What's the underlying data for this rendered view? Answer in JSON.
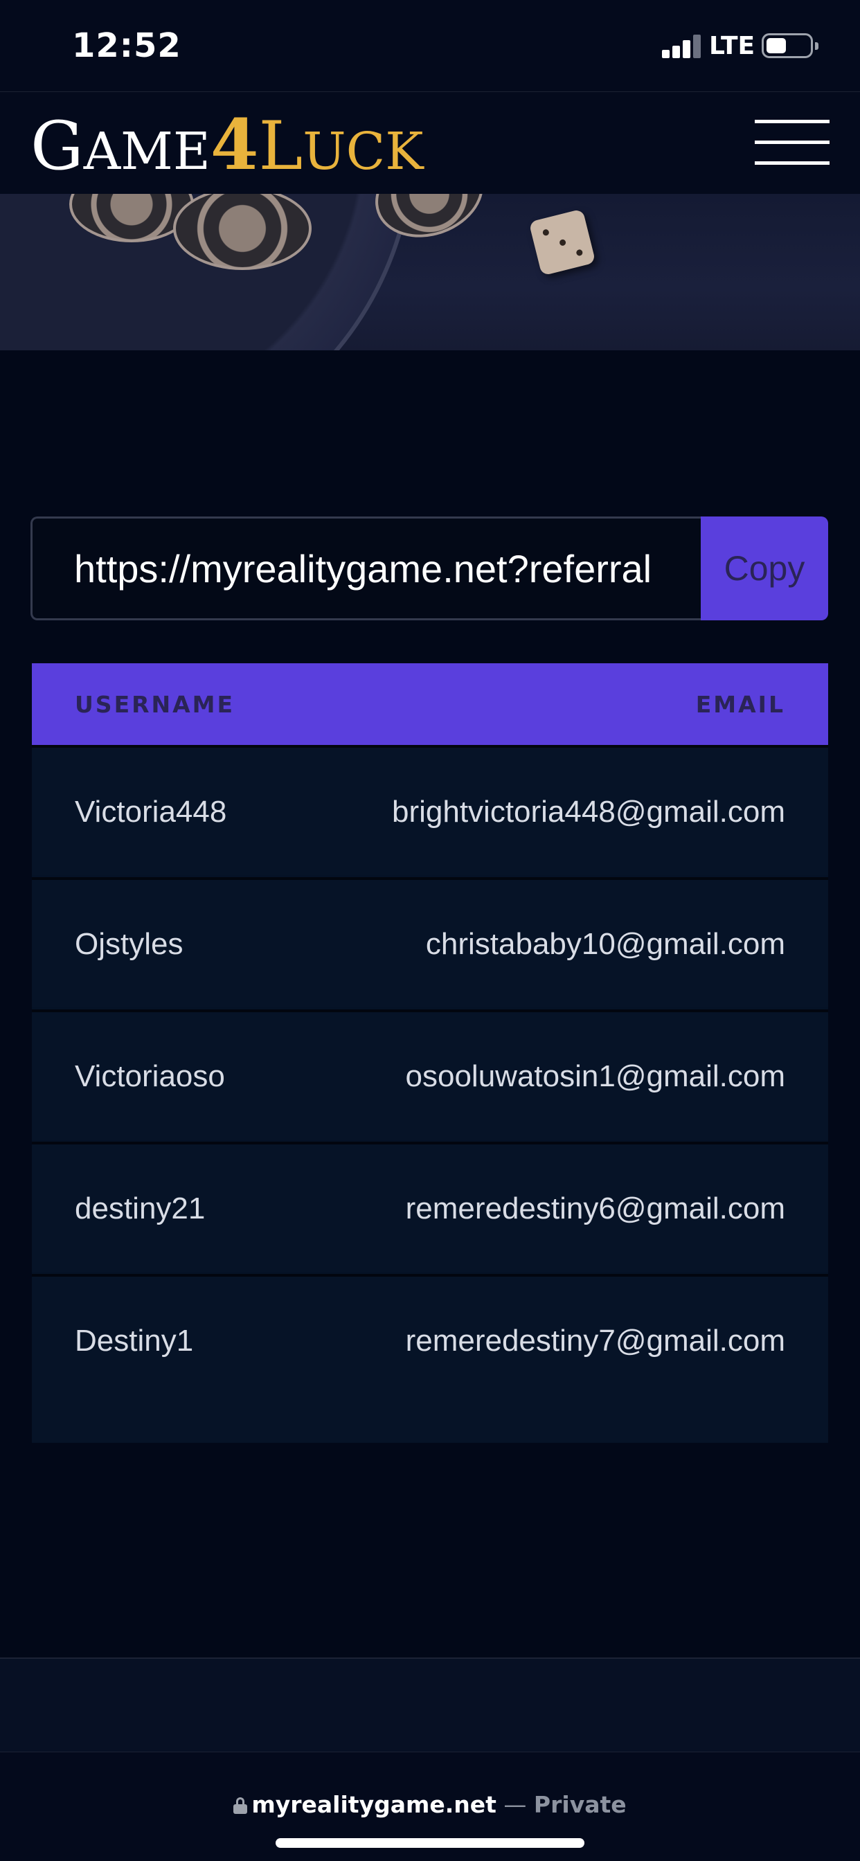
{
  "status_bar": {
    "time": "12:52",
    "network": "LTE",
    "icons": [
      "signal-icon",
      "battery-icon"
    ]
  },
  "header": {
    "logo": {
      "part1_initial": "G",
      "part1_rest": "AME",
      "part2_number": "4",
      "part2_initial": "L",
      "part2_rest": "UCK"
    },
    "menu_icon": "hamburger-menu-icon",
    "colors": {
      "logo_white": "#ffffff",
      "logo_gold": "#e9b33c"
    }
  },
  "referral": {
    "link_value": "https://myrealitygame.net?referral",
    "copy_label": "Copy"
  },
  "table": {
    "columns": [
      "USERNAME",
      "EMAIL"
    ],
    "rows": [
      {
        "username": "Victoria448",
        "email": "brightvictoria448@gmail.com"
      },
      {
        "username": "Ojstyles",
        "email": "christababy10@gmail.com"
      },
      {
        "username": "Victoriaoso",
        "email": "osooluwatosin1@gmail.com"
      },
      {
        "username": "destiny21",
        "email": "remeredestiny6@gmail.com"
      },
      {
        "username": "Destiny1",
        "email": "remeredestiny7@gmail.com"
      }
    ]
  },
  "browser": {
    "domain": "myrealitygame.net",
    "separator": "—",
    "mode": "Private",
    "lock_icon": "lock-icon"
  },
  "theme": {
    "accent": "#5a3fdd",
    "background": "#020818",
    "row_background": "#061327"
  }
}
